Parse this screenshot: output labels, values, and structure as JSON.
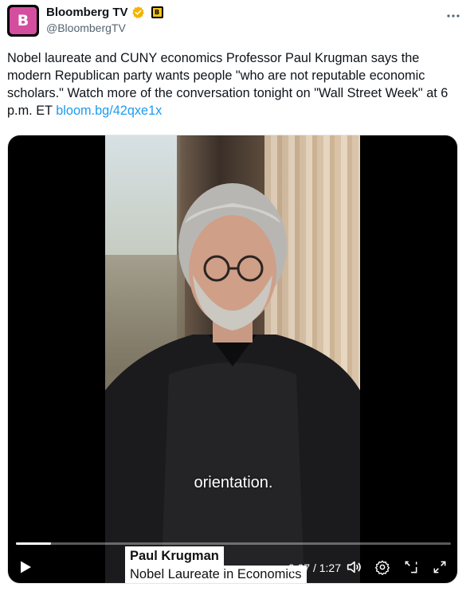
{
  "author": {
    "display_name": "Bloomberg TV",
    "handle": "@BloombergTV",
    "avatar_letter": "B",
    "affiliate_badge_letter": "B"
  },
  "tweet": {
    "text": "Nobel laureate and CUNY economics Professor Paul Krugman says the modern Republican party wants people \"who are not reputable economic scholars.\" Watch more of the conversation tonight on \"Wall Street Week\" at 6 p.m. ET ",
    "link": "bloom.bg/42qxe1x"
  },
  "video": {
    "lower_third_name": "Paul Krugman",
    "lower_third_title": "Nobel Laureate in Economics",
    "caption": "orientation.",
    "current_time": "0:07",
    "duration": "1:27",
    "time_separator": " / ",
    "progress_fraction": 0.08
  },
  "icons": {
    "more": "more-icon",
    "verified": "verified-badge-icon",
    "play": "play-icon",
    "volume": "volume-icon",
    "settings": "gear-icon",
    "pip": "picture-in-picture-icon",
    "fullscreen": "fullscreen-icon"
  },
  "colors": {
    "link": "#1d9bf0",
    "verified": "#f4b400",
    "avatar": "#d44ea0"
  }
}
